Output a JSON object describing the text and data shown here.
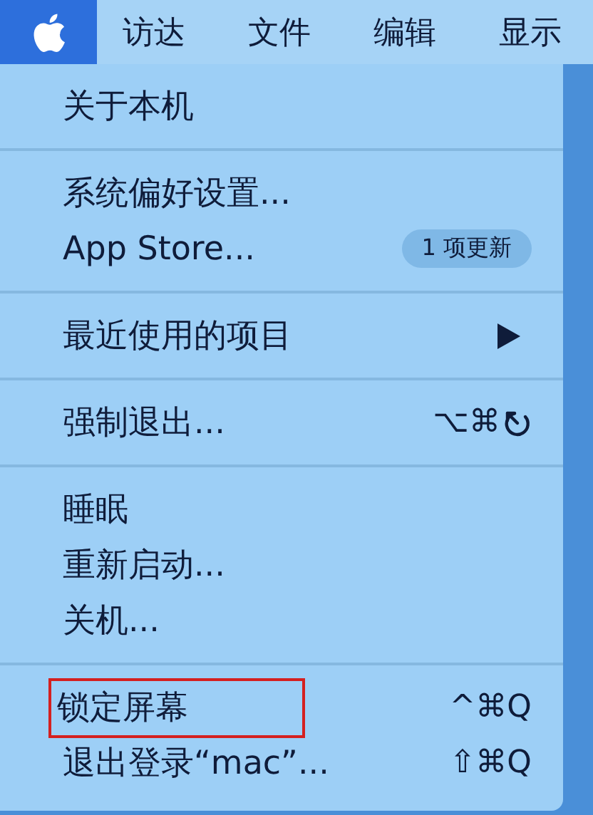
{
  "menu_bar": {
    "apple_selected": true,
    "items": [
      {
        "label": "访达"
      },
      {
        "label": "文件"
      },
      {
        "label": "编辑"
      },
      {
        "label": "显示"
      }
    ]
  },
  "menu": {
    "groups": [
      [
        {
          "label": "关于本机",
          "annotated": false
        }
      ],
      [
        {
          "label": "系统偏好设置...",
          "annotated": false
        },
        {
          "label": "App Store...",
          "badge": "1 项更新",
          "annotated": false
        }
      ],
      [
        {
          "label": "最近使用的项目",
          "submenu": true,
          "annotated": false
        }
      ],
      [
        {
          "label": "强制退出...",
          "shortcut": "⌥⌘",
          "kind": "escape-shortcut",
          "annotated": false
        }
      ],
      [
        {
          "label": "睡眠",
          "annotated": false
        },
        {
          "label": "重新启动...",
          "annotated": false
        },
        {
          "label": "关机...",
          "annotated": false
        }
      ],
      [
        {
          "label": "锁定屏幕",
          "shortcut": "^⌘Q",
          "annotated": true
        },
        {
          "label": "退出登录“mac”...",
          "shortcut": "⇧⌘Q",
          "annotated": false
        }
      ]
    ]
  }
}
